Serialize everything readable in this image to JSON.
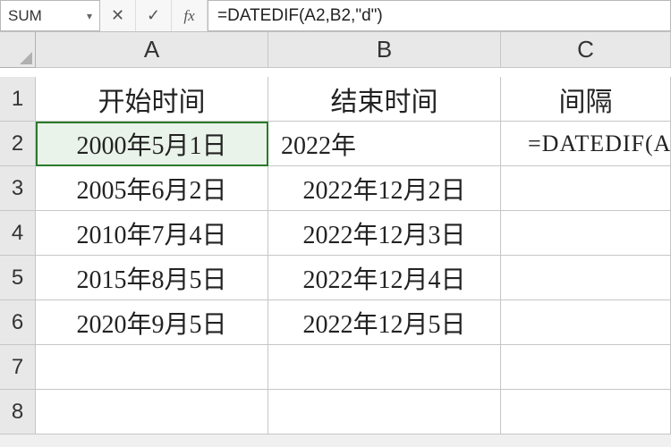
{
  "name_box": "SUM",
  "formula_bar": "=DATEDIF(A2,B2,\"d\")",
  "columns": [
    "A",
    "B",
    "C"
  ],
  "row_numbers": [
    1,
    2,
    3,
    4,
    5,
    6,
    7,
    8
  ],
  "headers": {
    "A": "开始时间",
    "B": "结束时间",
    "C": "间隔"
  },
  "rows": [
    {
      "a": "2000年5月1日",
      "b": "2022年",
      "c": "=DATEDIF(A"
    },
    {
      "a": "2005年6月2日",
      "b": "2022年12月2日",
      "c": ""
    },
    {
      "a": "2010年7月4日",
      "b": "2022年12月3日",
      "c": ""
    },
    {
      "a": "2015年8月5日",
      "b": "2022年12月4日",
      "c": ""
    },
    {
      "a": "2020年9月5日",
      "b": "2022年12月5日",
      "c": ""
    }
  ],
  "icons": {
    "cancel": "✕",
    "confirm": "✓",
    "fx": "fx",
    "dropdown": "▾"
  }
}
